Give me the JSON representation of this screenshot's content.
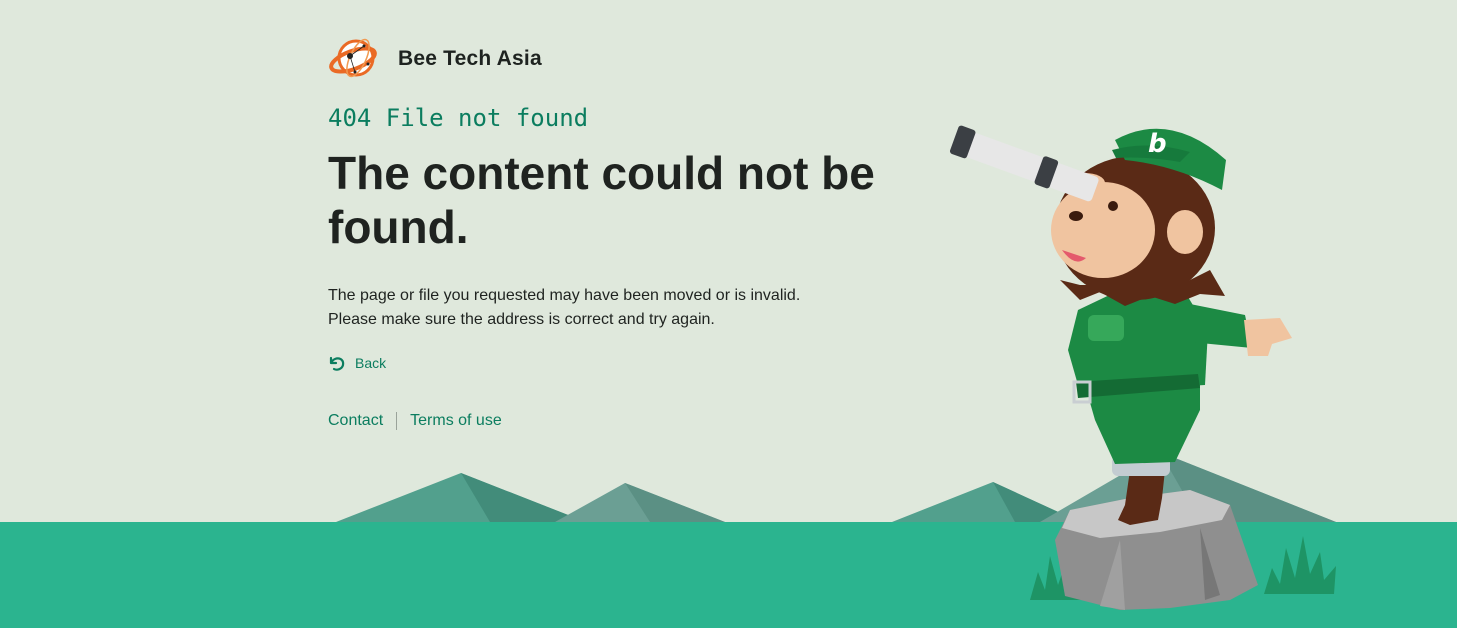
{
  "brand": {
    "name": "Bee Tech Asia",
    "logo_icon": "orbit-logo-icon"
  },
  "error": {
    "code_label": "404 File not found",
    "headline": "The content could not be found.",
    "description_line1": "The page or file you requested may have been moved or is invalid.",
    "description_line2": "Please make sure the address is correct and try again."
  },
  "back": {
    "label": "Back",
    "icon": "back-arrow-icon"
  },
  "footer": {
    "links": [
      "Contact",
      "Terms of use"
    ]
  },
  "colors": {
    "background": "#dfe8dc",
    "ground": "#2bb48f",
    "accent_text": "#0b7d5f",
    "heading_text": "#1f2320",
    "logo_orange": "#ea6a25",
    "mascot_uniform": "#1c8a44"
  }
}
